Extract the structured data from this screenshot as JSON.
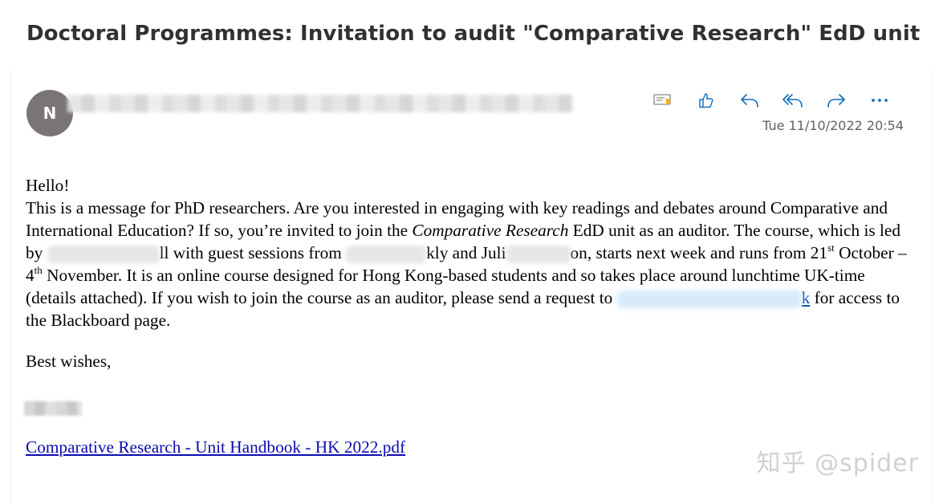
{
  "email": {
    "subject": "Doctoral Programmes: Invitation to audit \"Comparative Research\" EdD unit",
    "avatar_initial": "N",
    "timestamp": "Tue 11/10/2022 20:54"
  },
  "actions": [
    {
      "name": "sensitivity-label-icon"
    },
    {
      "name": "like-icon"
    },
    {
      "name": "reply-icon"
    },
    {
      "name": "reply-all-icon"
    },
    {
      "name": "forward-icon"
    },
    {
      "name": "more-options-icon"
    }
  ],
  "body": {
    "greeting": "Hello!",
    "p1_a": "This is a message for PhD researchers. Are you interested in engaging with key readings and debates around Comparative and International Education? If so, you’re invited to join the ",
    "p1_italic": "Comparative Research",
    "p1_b": " EdD unit as an auditor. The course, which is led by ",
    "p1_c": "ll with guest sessions from ",
    "p1_d": "kly and Juli",
    "p1_e": "on, starts next week and runs from 21",
    "p1_sup1": "st",
    "p1_f": " October – 4",
    "p1_sup2": "th",
    "p1_g": " November. It is an online course designed for Hong Kong-based students and so takes place around lunchtime UK-time (details attached). If you wish to join the course as an auditor, please send a request to ",
    "p1_link_tail": "k",
    "p1_h": " for access to the Blackboard page.",
    "closing": "Best wishes,"
  },
  "attachment": {
    "label": "Comparative Research - Unit Handbook - HK 2022.pdf"
  },
  "watermark": "知乎 @spider"
}
